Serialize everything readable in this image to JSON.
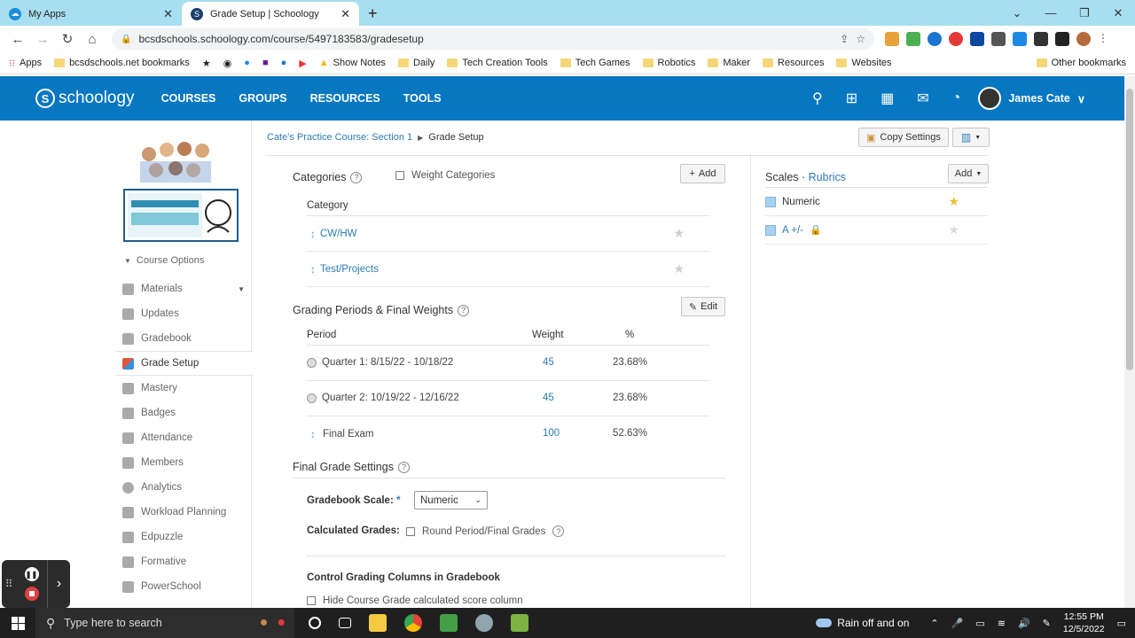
{
  "browser": {
    "tabs": [
      {
        "title": "My Apps",
        "active": false
      },
      {
        "title": "Grade Setup | Schoology",
        "active": true
      }
    ],
    "new_tab": "+",
    "url": "bcsdschools.schoology.com/course/5497183583/gradesetup",
    "bookmarks": [
      "Apps",
      "bcsdschools.net bookmarks",
      "Show Notes",
      "Daily",
      "Tech Creation Tools",
      "Tech Games",
      "Robotics",
      "Maker",
      "Resources",
      "Websites"
    ],
    "other_bookmarks": "Other bookmarks"
  },
  "header": {
    "logo": "schoology",
    "nav": [
      "COURSES",
      "GROUPS",
      "RESOURCES",
      "TOOLS"
    ],
    "user_name": "James Cate"
  },
  "sidebar": {
    "course_options": "Course Options",
    "items": [
      "Materials",
      "Updates",
      "Gradebook",
      "Grade Setup",
      "Mastery",
      "Badges",
      "Attendance",
      "Members",
      "Analytics",
      "Workload Planning",
      "Edpuzzle",
      "Formative",
      "PowerSchool"
    ],
    "active": "Grade Setup"
  },
  "breadcrumb": {
    "course": "Cate's Practice Course: Section 1",
    "current": "Grade Setup"
  },
  "toolbar": {
    "copy_settings": "Copy Settings"
  },
  "categories": {
    "title": "Categories",
    "weight_label": "Weight Categories",
    "add_label": "Add",
    "column": "Category",
    "rows": [
      "CW/HW",
      "Test/Projects"
    ]
  },
  "grading_periods": {
    "title": "Grading Periods & Final Weights",
    "edit_label": "Edit",
    "columns": {
      "period": "Period",
      "weight": "Weight",
      "percent": "%"
    },
    "rows": [
      {
        "name": "Quarter 1: 8/15/22 - 10/18/22",
        "weight": "45",
        "percent": "23.68%"
      },
      {
        "name": "Quarter 2: 10/19/22 - 12/16/22",
        "weight": "45",
        "percent": "23.68%"
      },
      {
        "name": "Final Exam",
        "weight": "100",
        "percent": "52.63%"
      }
    ]
  },
  "final_grade": {
    "title": "Final Grade Settings",
    "scale_label": "Gradebook Scale:",
    "required_mark": "*",
    "scale_value": "Numeric",
    "calc_label": "Calculated Grades:",
    "round_label": "Round Period/Final Grades",
    "control_title": "Control Grading Columns in Gradebook",
    "hide_label": "Hide Course Grade calculated score column"
  },
  "scales": {
    "title": "Scales",
    "separator": " · ",
    "rubrics": "Rubrics",
    "add_label": "Add",
    "rows": [
      {
        "name": "Numeric",
        "default": true
      },
      {
        "name": "A +/-",
        "default": false
      }
    ]
  },
  "taskbar": {
    "search_placeholder": "Type here to search",
    "weather": "Rain off and on",
    "time": "12:55 PM",
    "date": "12/5/2022"
  },
  "colors": {
    "brand": "#0677c0",
    "link": "#2d7bb5",
    "star_default": "#e8c23a"
  }
}
